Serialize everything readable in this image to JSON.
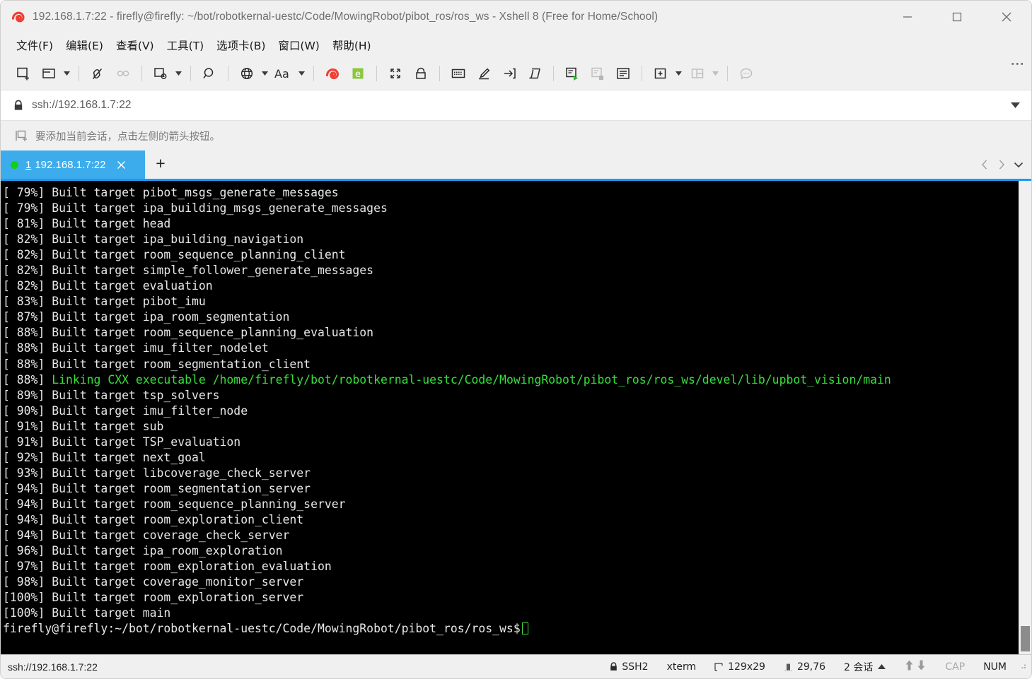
{
  "window": {
    "title": "192.168.1.7:22 - firefly@firefly: ~/bot/robotkernal-uestc/Code/MowingRobot/pibot_ros/ros_ws - Xshell 8 (Free for Home/School)",
    "logo_icon": "xshell-spiral-logo",
    "controls": {
      "minimize": "minimize-icon",
      "maximize": "maximize-icon",
      "close": "close-icon"
    }
  },
  "menubar": {
    "items": [
      {
        "label": "文件(F)",
        "name": "menu-file"
      },
      {
        "label": "编辑(E)",
        "name": "menu-edit"
      },
      {
        "label": "查看(V)",
        "name": "menu-view"
      },
      {
        "label": "工具(T)",
        "name": "menu-tools"
      },
      {
        "label": "选项卡(B)",
        "name": "menu-tabs"
      },
      {
        "label": "窗口(W)",
        "name": "menu-window"
      },
      {
        "label": "帮助(H)",
        "name": "menu-help"
      }
    ]
  },
  "toolbar": {
    "overflow_label": "⋮",
    "items": [
      {
        "icon": "new-session-icon",
        "caret": false
      },
      {
        "icon": "open-folder-icon",
        "caret": true
      },
      {
        "icon": "disconnect-icon",
        "caret": false
      },
      {
        "icon": "link-icon",
        "caret": false,
        "disabled": true
      },
      {
        "icon": "session-properties-icon",
        "caret": true
      },
      {
        "icon": "search-icon",
        "caret": false
      },
      {
        "icon": "globe-encoding-icon",
        "caret": true
      },
      {
        "icon": "font-size-icon",
        "caret": true
      },
      {
        "icon": "xshell-icon",
        "caret": false
      },
      {
        "icon": "xftp-icon",
        "caret": false
      },
      {
        "icon": "fullscreen-icon",
        "caret": false
      },
      {
        "icon": "lock-icon",
        "caret": false
      },
      {
        "icon": "keyboard-icon",
        "caret": false
      },
      {
        "icon": "highlight-icon",
        "caret": false
      },
      {
        "icon": "send-key-icon",
        "caret": false
      },
      {
        "icon": "scroll-log-icon",
        "caret": false
      },
      {
        "icon": "script-run-icon",
        "caret": false
      },
      {
        "icon": "script-stop-icon",
        "caret": false,
        "disabled": true
      },
      {
        "icon": "compose-pane-icon",
        "caret": false
      },
      {
        "icon": "add-pane-icon",
        "caret": true
      },
      {
        "icon": "split-layout-icon",
        "caret": true,
        "disabled": true
      },
      {
        "icon": "chat-icon",
        "caret": false,
        "disabled": true
      }
    ]
  },
  "address_bar": {
    "lock_icon": "lock-closed-icon",
    "value": "ssh://192.168.1.7:22",
    "caret_icon": "chevron-down-icon"
  },
  "hint_bar": {
    "icon": "add-session-icon",
    "text": "要添加当前会话，点击左侧的箭头按钮。"
  },
  "tabs": {
    "active": {
      "status_icon": "connected-dot",
      "number": "1",
      "label": "192.168.1.7:22",
      "close_icon": "close-icon"
    },
    "new_tab_label": "+",
    "nav": {
      "prev_icon": "chevron-left-icon",
      "next_icon": "chevron-right-icon",
      "list_icon": "chevron-down-icon"
    }
  },
  "terminal": {
    "lines": [
      {
        "text": "[ 79%] Built target pibot_msgs_generate_messages"
      },
      {
        "text": "[ 79%] Built target ipa_building_msgs_generate_messages"
      },
      {
        "text": "[ 81%] Built target head"
      },
      {
        "text": "[ 82%] Built target ipa_building_navigation"
      },
      {
        "text": "[ 82%] Built target room_sequence_planning_client"
      },
      {
        "text": "[ 82%] Built target simple_follower_generate_messages"
      },
      {
        "text": "[ 82%] Built target evaluation"
      },
      {
        "text": "[ 83%] Built target pibot_imu"
      },
      {
        "text": "[ 87%] Built target ipa_room_segmentation"
      },
      {
        "text": "[ 88%] Built target room_sequence_planning_evaluation"
      },
      {
        "text": "[ 88%] Built target imu_filter_nodelet"
      },
      {
        "text": "[ 88%] Built target room_segmentation_client"
      },
      {
        "prefix": "[ 88%] ",
        "green": "Linking CXX executable /home/firefly/bot/robotkernal-uestc/Code/MowingRobot/pibot_ros/ros_ws/devel/lib/upbot_vision/main"
      },
      {
        "text": "[ 89%] Built target tsp_solvers"
      },
      {
        "text": "[ 90%] Built target imu_filter_node"
      },
      {
        "text": "[ 91%] Built target sub"
      },
      {
        "text": "[ 91%] Built target TSP_evaluation"
      },
      {
        "text": "[ 92%] Built target next_goal"
      },
      {
        "text": "[ 93%] Built target libcoverage_check_server"
      },
      {
        "text": "[ 94%] Built target room_segmentation_server"
      },
      {
        "text": "[ 94%] Built target room_sequence_planning_server"
      },
      {
        "text": "[ 94%] Built target room_exploration_client"
      },
      {
        "text": "[ 94%] Built target coverage_check_server"
      },
      {
        "text": "[ 96%] Built target ipa_room_exploration"
      },
      {
        "text": "[ 97%] Built target room_exploration_evaluation"
      },
      {
        "text": "[ 98%] Built target coverage_monitor_server"
      },
      {
        "text": "[100%] Built target room_exploration_server"
      },
      {
        "text": "[100%] Built target main"
      }
    ],
    "prompt": "firefly@firefly:~/bot/robotkernal-uestc/Code/MowingRobot/pibot_ros/ros_ws$",
    "colors": {
      "background": "#000000",
      "foreground": "#e8e8e8",
      "green": "#35e03a"
    }
  },
  "statusbar": {
    "connection": "ssh://192.168.1.7:22",
    "protocol": "SSH2",
    "protocol_icon": "lock-closed-icon",
    "term_type": "xterm",
    "size_icon": "screen-size-icon",
    "size": "129x29",
    "cursor_icon": "cursor-position-icon",
    "cursor": "29,76",
    "sessions": "2 会话",
    "sessions_caret": "chevron-up-icon",
    "transfer_up_icon": "arrow-up-icon",
    "transfer_down_icon": "arrow-down-icon",
    "caps": "CAP",
    "num": "NUM",
    "resize_grip": "resize-grip-icon"
  }
}
